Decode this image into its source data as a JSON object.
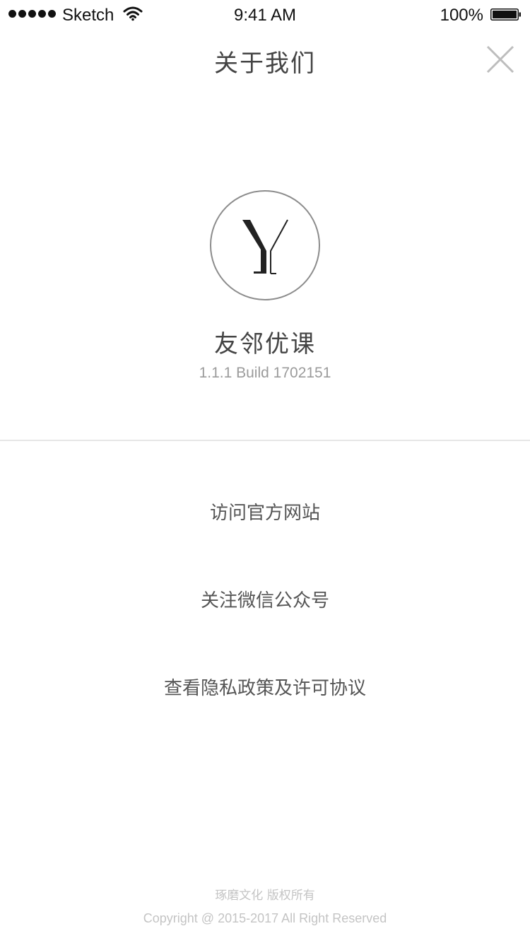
{
  "status_bar": {
    "carrier": "Sketch",
    "time": "9:41 AM",
    "battery": "100%",
    "icons": [
      "signal-icon",
      "wifi-icon",
      "battery-icon"
    ]
  },
  "nav": {
    "title": "关于我们",
    "close_icon": "close-icon"
  },
  "app": {
    "logo_icon": "app-logo-icon",
    "name": "友邻优课",
    "version": "1.1.1 Build 1702151"
  },
  "menu": [
    {
      "label": "访问官方网站"
    },
    {
      "label": "关注微信公众号"
    },
    {
      "label": "查看隐私政策及许可协议"
    }
  ],
  "footer": {
    "company": "琢磨文化 版权所有",
    "copyright": "Copyright @ 2015-2017 All Right Reserved"
  },
  "colors": {
    "title_text": "#444444",
    "link_text": "#555555",
    "version_text": "#9b9b9b",
    "footer_text": "#c4c4c4",
    "logo_border": "#8c8c8c",
    "divider": "#e6e6e6"
  }
}
